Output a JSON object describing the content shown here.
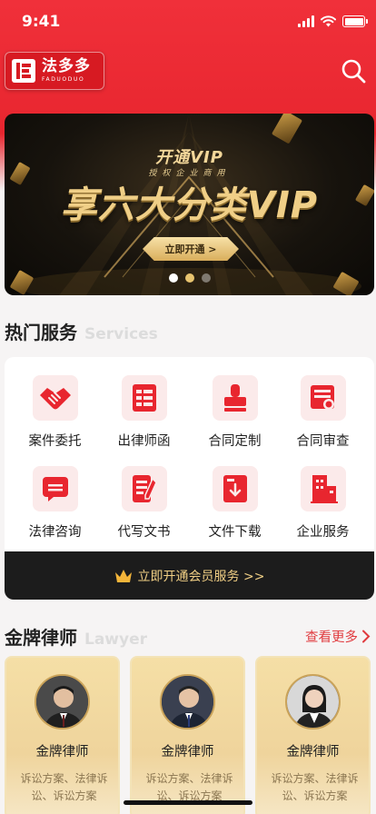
{
  "status_bar": {
    "time": "9:41"
  },
  "header": {
    "logo_cn": "法多多",
    "logo_en": "FADUODUO"
  },
  "banner": {
    "subtitle": "开通VIP",
    "subtitle2": "授权企业商用",
    "title": "享六大分类VIP",
    "button_label": "立即开通 >",
    "slide_count": 3,
    "active_slide": 1
  },
  "services_section": {
    "title": "热门服务",
    "title_en": "Services",
    "items": [
      {
        "label": "案件委托",
        "icon": "handshake-icon"
      },
      {
        "label": "出律师函",
        "icon": "letter-icon"
      },
      {
        "label": "合同定制",
        "icon": "stamp-icon"
      },
      {
        "label": "合同审查",
        "icon": "contract-review-icon"
      },
      {
        "label": "法律咨询",
        "icon": "chat-icon"
      },
      {
        "label": "代写文书",
        "icon": "pen-document-icon"
      },
      {
        "label": "文件下载",
        "icon": "download-icon"
      },
      {
        "label": "企业服务",
        "icon": "building-icon"
      }
    ],
    "vip_bar_label": "立即开通会员服务 >>"
  },
  "lawyer_section": {
    "title": "金牌律师",
    "title_en": "Lawyer",
    "more_label": "查看更多",
    "lawyers": [
      {
        "name": "金牌律师",
        "desc": "诉讼方案、法律诉讼、诉讼方案"
      },
      {
        "name": "金牌律师",
        "desc": "诉讼方案、法律诉讼、诉讼方案"
      },
      {
        "name": "金牌律师",
        "desc": "诉讼方案、法律诉讼、诉讼方案"
      }
    ]
  },
  "colors": {
    "brand_red": "#e8262f",
    "gold": "#f1cf85",
    "dark": "#1c1c1c"
  }
}
